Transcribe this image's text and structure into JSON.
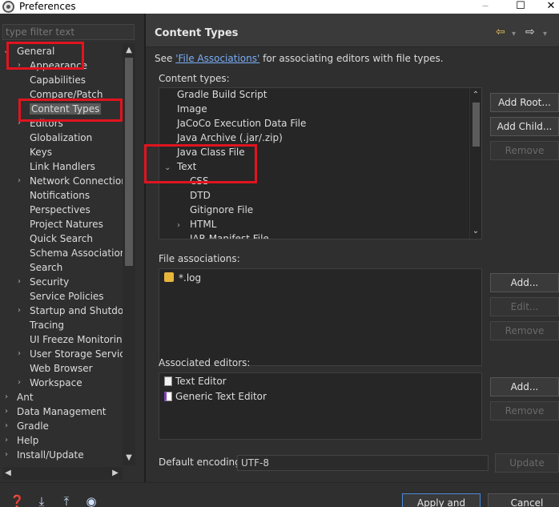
{
  "window": {
    "title": "Preferences",
    "minimize": "‒",
    "maximize": "☐",
    "close": "✕"
  },
  "filter": {
    "placeholder": "type filter text"
  },
  "tree": [
    {
      "label": "General",
      "arrow": "⌄",
      "indent": 1,
      "selected": false
    },
    {
      "label": "Appearance",
      "arrow": "›",
      "indent": 2,
      "selected": false
    },
    {
      "label": "Capabilities",
      "arrow": "",
      "indent": 2,
      "selected": false
    },
    {
      "label": "Compare/Patch",
      "arrow": "",
      "indent": 2,
      "selected": false
    },
    {
      "label": "Content Types",
      "arrow": "",
      "indent": 2,
      "selected": true
    },
    {
      "label": "Editors",
      "arrow": "›",
      "indent": 2,
      "selected": false
    },
    {
      "label": "Globalization",
      "arrow": "",
      "indent": 2,
      "selected": false
    },
    {
      "label": "Keys",
      "arrow": "",
      "indent": 2,
      "selected": false
    },
    {
      "label": "Link Handlers",
      "arrow": "",
      "indent": 2,
      "selected": false
    },
    {
      "label": "Network Connections",
      "arrow": "›",
      "indent": 2,
      "selected": false
    },
    {
      "label": "Notifications",
      "arrow": "",
      "indent": 2,
      "selected": false
    },
    {
      "label": "Perspectives",
      "arrow": "",
      "indent": 2,
      "selected": false
    },
    {
      "label": "Project Natures",
      "arrow": "",
      "indent": 2,
      "selected": false
    },
    {
      "label": "Quick Search",
      "arrow": "",
      "indent": 2,
      "selected": false
    },
    {
      "label": "Schema Associations",
      "arrow": "",
      "indent": 2,
      "selected": false
    },
    {
      "label": "Search",
      "arrow": "",
      "indent": 2,
      "selected": false
    },
    {
      "label": "Security",
      "arrow": "›",
      "indent": 2,
      "selected": false
    },
    {
      "label": "Service Policies",
      "arrow": "",
      "indent": 2,
      "selected": false
    },
    {
      "label": "Startup and Shutdown",
      "arrow": "›",
      "indent": 2,
      "selected": false
    },
    {
      "label": "Tracing",
      "arrow": "",
      "indent": 2,
      "selected": false
    },
    {
      "label": "UI Freeze Monitoring",
      "arrow": "",
      "indent": 2,
      "selected": false
    },
    {
      "label": "User Storage Service",
      "arrow": "›",
      "indent": 2,
      "selected": false
    },
    {
      "label": "Web Browser",
      "arrow": "",
      "indent": 2,
      "selected": false
    },
    {
      "label": "Workspace",
      "arrow": "›",
      "indent": 2,
      "selected": false
    },
    {
      "label": "Ant",
      "arrow": "›",
      "indent": 1,
      "selected": false
    },
    {
      "label": "Data Management",
      "arrow": "›",
      "indent": 1,
      "selected": false
    },
    {
      "label": "Gradle",
      "arrow": "›",
      "indent": 1,
      "selected": false
    },
    {
      "label": "Help",
      "arrow": "›",
      "indent": 1,
      "selected": false
    },
    {
      "label": "Install/Update",
      "arrow": "›",
      "indent": 1,
      "selected": false
    }
  ],
  "page": {
    "title": "Content Types",
    "nav_back": "⇦",
    "nav_forward": "⇨",
    "nav_menu": "▾",
    "see_prefix": "See ",
    "see_link": "'File Associations'",
    "see_suffix": " for associating editors with file types."
  },
  "content_types": {
    "label": "Content types:",
    "items": [
      {
        "label": "Gradle Build Script",
        "arrow": "",
        "indent": 1
      },
      {
        "label": "Image",
        "arrow": "",
        "indent": 1
      },
      {
        "label": "JaCoCo Execution Data File",
        "arrow": "",
        "indent": 1
      },
      {
        "label": "Java Archive (.jar/.zip)",
        "arrow": "",
        "indent": 1
      },
      {
        "label": "Java Class File",
        "arrow": "",
        "indent": 1
      },
      {
        "label": "Text",
        "arrow": "⌄",
        "indent": 1
      },
      {
        "label": "CSS",
        "arrow": "",
        "indent": 2
      },
      {
        "label": "DTD",
        "arrow": "",
        "indent": 2
      },
      {
        "label": "Gitignore File",
        "arrow": "",
        "indent": 2
      },
      {
        "label": "HTML",
        "arrow": "›",
        "indent": 2
      },
      {
        "label": "JAR Manifest File",
        "arrow": "",
        "indent": 2
      }
    ],
    "add_root": "Add Root...",
    "add_child": "Add Child...",
    "remove": "Remove"
  },
  "file_associations": {
    "label": "File associations:",
    "items": [
      "*.log"
    ],
    "add": "Add...",
    "edit": "Edit...",
    "remove": "Remove"
  },
  "associated_editors": {
    "label": "Associated editors:",
    "items": [
      "Text Editor",
      "Generic Text Editor"
    ],
    "add": "Add...",
    "remove": "Remove"
  },
  "encoding": {
    "label": "Default encoding:",
    "value": "UTF-8",
    "update": "Update"
  },
  "footer": {
    "apply_close": "Apply and Close",
    "cancel": "Cancel"
  }
}
